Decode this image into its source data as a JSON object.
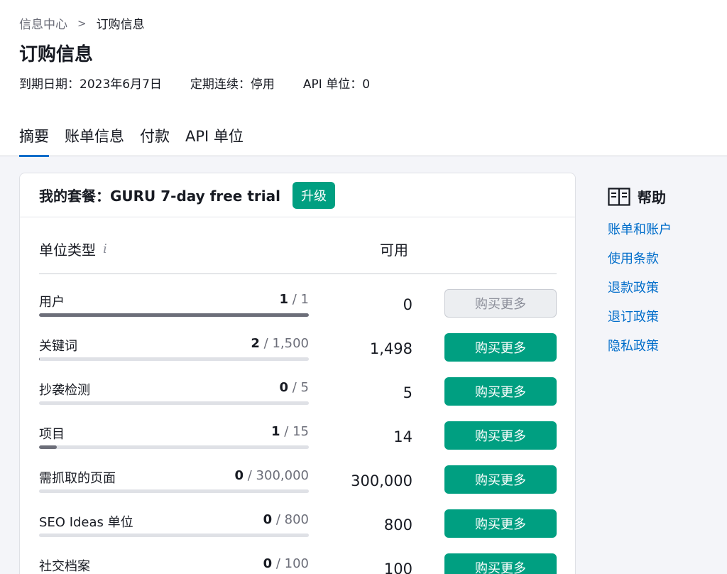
{
  "breadcrumb": {
    "parent": "信息中心",
    "separator": ">",
    "current": "订购信息"
  },
  "page_title": "订购信息",
  "meta": {
    "expiry": "到期日期：2023年6月7日",
    "renewal": "定期连续：停用",
    "api_units": "API 单位：0"
  },
  "tabs": [
    {
      "label": "摘要",
      "active": true
    },
    {
      "label": "账单信息",
      "active": false
    },
    {
      "label": "付款",
      "active": false
    },
    {
      "label": "API 单位",
      "active": false
    }
  ],
  "plan": {
    "title": "我的套餐：GURU 7-day free trial",
    "upgrade_label": "升级"
  },
  "columns": {
    "type": "单位类型",
    "info_icon": "i",
    "available": "可用"
  },
  "rows": [
    {
      "label": "用户",
      "used": "1",
      "limit": "/ 1",
      "fill_fraction": 1.0,
      "available": "0",
      "buy_label": "购买更多",
      "disabled": true
    },
    {
      "label": "关键词",
      "used": "2",
      "limit": "/ 1,500",
      "fill_fraction": 0.0013,
      "available": "1,498",
      "buy_label": "购买更多",
      "disabled": false
    },
    {
      "label": "抄袭检测",
      "used": "0",
      "limit": "/ 5",
      "fill_fraction": 0.0,
      "available": "5",
      "buy_label": "购买更多",
      "disabled": false
    },
    {
      "label": "项目",
      "used": "1",
      "limit": "/ 15",
      "fill_fraction": 0.0667,
      "available": "14",
      "buy_label": "购买更多",
      "disabled": false
    },
    {
      "label": "需抓取的页面",
      "used": "0",
      "limit": "/ 300,000",
      "fill_fraction": 0.0,
      "available": "300,000",
      "buy_label": "购买更多",
      "disabled": false
    },
    {
      "label": "SEO Ideas 单位",
      "used": "0",
      "limit": "/ 800",
      "fill_fraction": 0.0,
      "available": "800",
      "buy_label": "购买更多",
      "disabled": false
    },
    {
      "label": "社交档案",
      "used": "0",
      "limit": "/ 100",
      "fill_fraction": 0.0,
      "available": "100",
      "buy_label": "购买更多",
      "disabled": false
    }
  ],
  "help": {
    "title": "帮助",
    "icon": "book-icon",
    "links": [
      "账单和账户",
      "使用条款",
      "退款政策",
      "退订政策",
      "隐私政策"
    ]
  },
  "colors": {
    "accent": "#009f81",
    "link": "#006dca",
    "tab_underline": "#006dca"
  }
}
